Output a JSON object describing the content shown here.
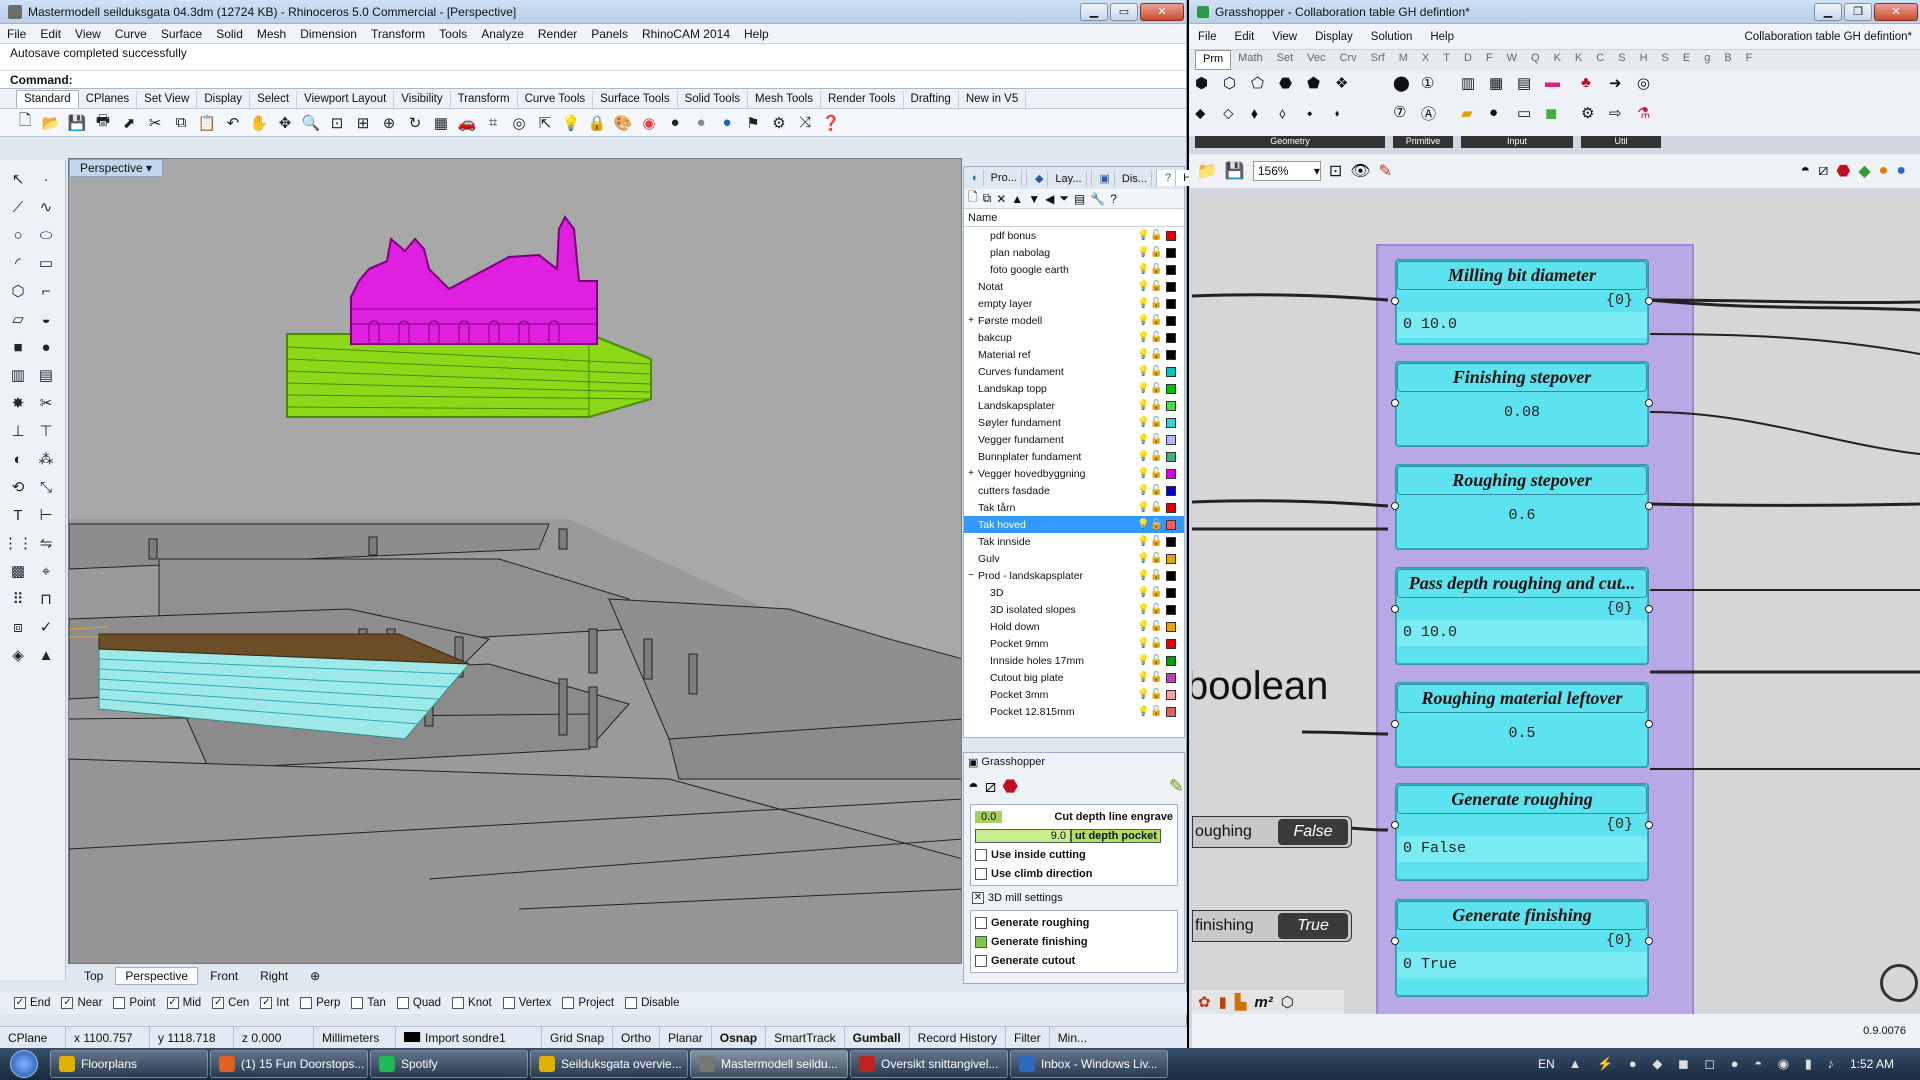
{
  "rhino": {
    "title": "Mastermodell seilduksgata 04.3dm (12724 KB) - Rhinoceros 5.0 Commercial - [Perspective]",
    "menu": [
      "File",
      "Edit",
      "View",
      "Curve",
      "Surface",
      "Solid",
      "Mesh",
      "Dimension",
      "Transform",
      "Tools",
      "Analyze",
      "Render",
      "Panels",
      "RhinoCAM 2014",
      "Help"
    ],
    "autosave": "Autosave completed successfully",
    "command_label": "Command:",
    "toolbar_tabs": [
      "Standard",
      "CPlanes",
      "Set View",
      "Display",
      "Select",
      "Viewport Layout",
      "Visibility",
      "Transform",
      "Curve Tools",
      "Surface Tools",
      "Solid Tools",
      "Mesh Tools",
      "Render Tools",
      "Drafting",
      "New in V5"
    ],
    "viewport_label": "Perspective",
    "viewport_tabs": [
      "Top",
      "Perspective",
      "Front",
      "Right"
    ],
    "osnaps": [
      {
        "label": "End",
        "checked": true
      },
      {
        "label": "Near",
        "checked": true
      },
      {
        "label": "Point",
        "checked": false
      },
      {
        "label": "Mid",
        "checked": true
      },
      {
        "label": "Cen",
        "checked": true
      },
      {
        "label": "Int",
        "checked": true
      },
      {
        "label": "Perp",
        "checked": false
      },
      {
        "label": "Tan",
        "checked": false
      },
      {
        "label": "Quad",
        "checked": false
      },
      {
        "label": "Knot",
        "checked": false
      },
      {
        "label": "Vertex",
        "checked": false
      },
      {
        "label": "Project",
        "checked": false
      },
      {
        "label": "Disable",
        "checked": false
      }
    ],
    "status": {
      "cplane": "CPlane",
      "x": "x 1100.757",
      "y": "y 1118.718",
      "z": "z 0.000",
      "units": "Millimeters",
      "layer": "Import sondre1",
      "grid_snap": "Grid Snap",
      "ortho": "Ortho",
      "planar": "Planar",
      "osnap": "Osnap",
      "smarttrack": "SmartTrack",
      "gumball": "Gumball",
      "record_history": "Record History",
      "filter": "Filter",
      "min": "Min..."
    },
    "panel_tabs": [
      "Pro...",
      "Lay...",
      "Dis...",
      "Help"
    ],
    "layers_header": "Name",
    "layers": [
      {
        "name": "pdf bonus",
        "indent": 2,
        "color": "#e00000",
        "bulb": "on"
      },
      {
        "name": "plan nabolag",
        "indent": 2,
        "color": "#000000",
        "bulb": "on"
      },
      {
        "name": "foto google earth",
        "indent": 2,
        "color": "#000000",
        "bulb": "on"
      },
      {
        "name": "Notat",
        "indent": 1,
        "color": "#000000",
        "bulb": "on"
      },
      {
        "name": "empty layer",
        "indent": 1,
        "color": "#000000",
        "bulb": "off"
      },
      {
        "name": "Første modell",
        "indent": 1,
        "color": "#000000",
        "bulb": "on",
        "expand": "+"
      },
      {
        "name": "bakcup",
        "indent": 1,
        "color": "#000000",
        "bulb": "off"
      },
      {
        "name": "Material ref",
        "indent": 1,
        "color": "#000000",
        "bulb": "off"
      },
      {
        "name": "Curves fundament",
        "indent": 1,
        "color": "#00c8c8",
        "bulb": "on"
      },
      {
        "name": "Landskap topp",
        "indent": 1,
        "color": "#00c000",
        "bulb": "on"
      },
      {
        "name": "Landskapsplater",
        "indent": 1,
        "color": "#40e040",
        "bulb": "off"
      },
      {
        "name": "Søyler fundament",
        "indent": 1,
        "color": "#30d8d8",
        "bulb": "on"
      },
      {
        "name": "Vegger fundament",
        "indent": 1,
        "color": "#b8b8ff",
        "bulb": "on"
      },
      {
        "name": "Bunnplater fundament",
        "indent": 1,
        "color": "#3cb371",
        "bulb": "off"
      },
      {
        "name": "Vegger hovedbyggning",
        "indent": 1,
        "color": "#e000e0",
        "bulb": "on",
        "expand": "+"
      },
      {
        "name": "cutters fasdade",
        "indent": 1,
        "color": "#0000d0",
        "bulb": "on"
      },
      {
        "name": "Tak tårn",
        "indent": 1,
        "color": "#e00000",
        "bulb": "on"
      },
      {
        "name": "Tak hoved",
        "indent": 1,
        "color": "#ff5a5a",
        "bulb": "off",
        "selected": true
      },
      {
        "name": "Tak innside",
        "indent": 1,
        "color": "#000000",
        "bulb": "on"
      },
      {
        "name": "Gulv",
        "indent": 1,
        "color": "#f0a000",
        "bulb": "on"
      },
      {
        "name": "Prod - landskapsplater",
        "indent": 1,
        "color": "#000000",
        "bulb": "on",
        "expand": "−"
      },
      {
        "name": "3D",
        "indent": 2,
        "color": "#000000",
        "bulb": "on"
      },
      {
        "name": "3D isolated slopes",
        "indent": 2,
        "color": "#000000",
        "bulb": "on"
      },
      {
        "name": "Hold down",
        "indent": 2,
        "color": "#f0a000",
        "bulb": "off"
      },
      {
        "name": "Pocket 9mm",
        "indent": 2,
        "color": "#e00000",
        "bulb": "on"
      },
      {
        "name": "Innside holes 17mm",
        "indent": 2,
        "color": "#00a000",
        "bulb": "on"
      },
      {
        "name": "Cutout big plate",
        "indent": 2,
        "color": "#c040c0",
        "bulb": "on"
      },
      {
        "name": "Pocket 3mm",
        "indent": 2,
        "color": "#ff9aaa",
        "bulb": "off"
      },
      {
        "name": "Pocket 12.815mm",
        "indent": 2,
        "color": "#e06060",
        "bulb": "on"
      }
    ],
    "gh_panel": {
      "title": "Grasshopper",
      "slider1_value": "0.0",
      "slider1_label": "Cut depth line engrave",
      "slider2_value": "9.0",
      "slider2_label": "ut depth pocket",
      "cb_inside": "Use inside cutting",
      "cb_climb": "Use climb direction",
      "section": "3D mill settings",
      "gen_roughing": "Generate roughing",
      "gen_finishing": "Generate finishing",
      "gen_cutout": "Generate cutout"
    }
  },
  "gh": {
    "title": "Grasshopper - Collaboration table GH defintion*",
    "menu": [
      "File",
      "Edit",
      "View",
      "Display",
      "Solution",
      "Help"
    ],
    "doc_name": "Collaboration table GH defintion*",
    "tabs": [
      "Prm",
      "Math",
      "Set",
      "Vec",
      "Crv",
      "Srf",
      "M",
      "X",
      "T",
      "D",
      "F",
      "W",
      "Q",
      "K",
      "K",
      "C",
      "S",
      "H",
      "S",
      "E",
      "g",
      "B",
      "F"
    ],
    "groups": [
      "Geometry",
      "Primitive",
      "Input",
      "Util"
    ],
    "zoom": "156%",
    "canvas_text": "boolean",
    "toggles": [
      {
        "label": "oughing",
        "value": "False"
      },
      {
        "label": "finishing",
        "value": "True"
      }
    ],
    "params": [
      {
        "title": "Milling bit diameter",
        "path": "{0}",
        "value": "0 10.0"
      },
      {
        "title": "Finishing stepover",
        "path": "",
        "value": "0.08"
      },
      {
        "title": "Roughing stepover",
        "path": "",
        "value": "0.6"
      },
      {
        "title": "Pass depth roughing and cut...",
        "path": "{0}",
        "value": "0 10.0"
      },
      {
        "title": "Roughing material leftover",
        "path": "",
        "value": "0.5"
      },
      {
        "title": "Generate roughing",
        "path": "{0}",
        "value": "0 False"
      },
      {
        "title": "Generate finishing",
        "path": "{0}",
        "value": "0 True"
      }
    ],
    "version": "0.9.0076"
  },
  "taskbar": {
    "items": [
      "Floorplans",
      "(1) 15 Fun Doorstops...",
      "Spotify",
      "Seilduksgata overvie...",
      "Mastermodell seildu...",
      "Oversikt snittangivel...",
      "Inbox - Windows Liv..."
    ],
    "lang": "EN",
    "clock": "1:52 AM"
  }
}
